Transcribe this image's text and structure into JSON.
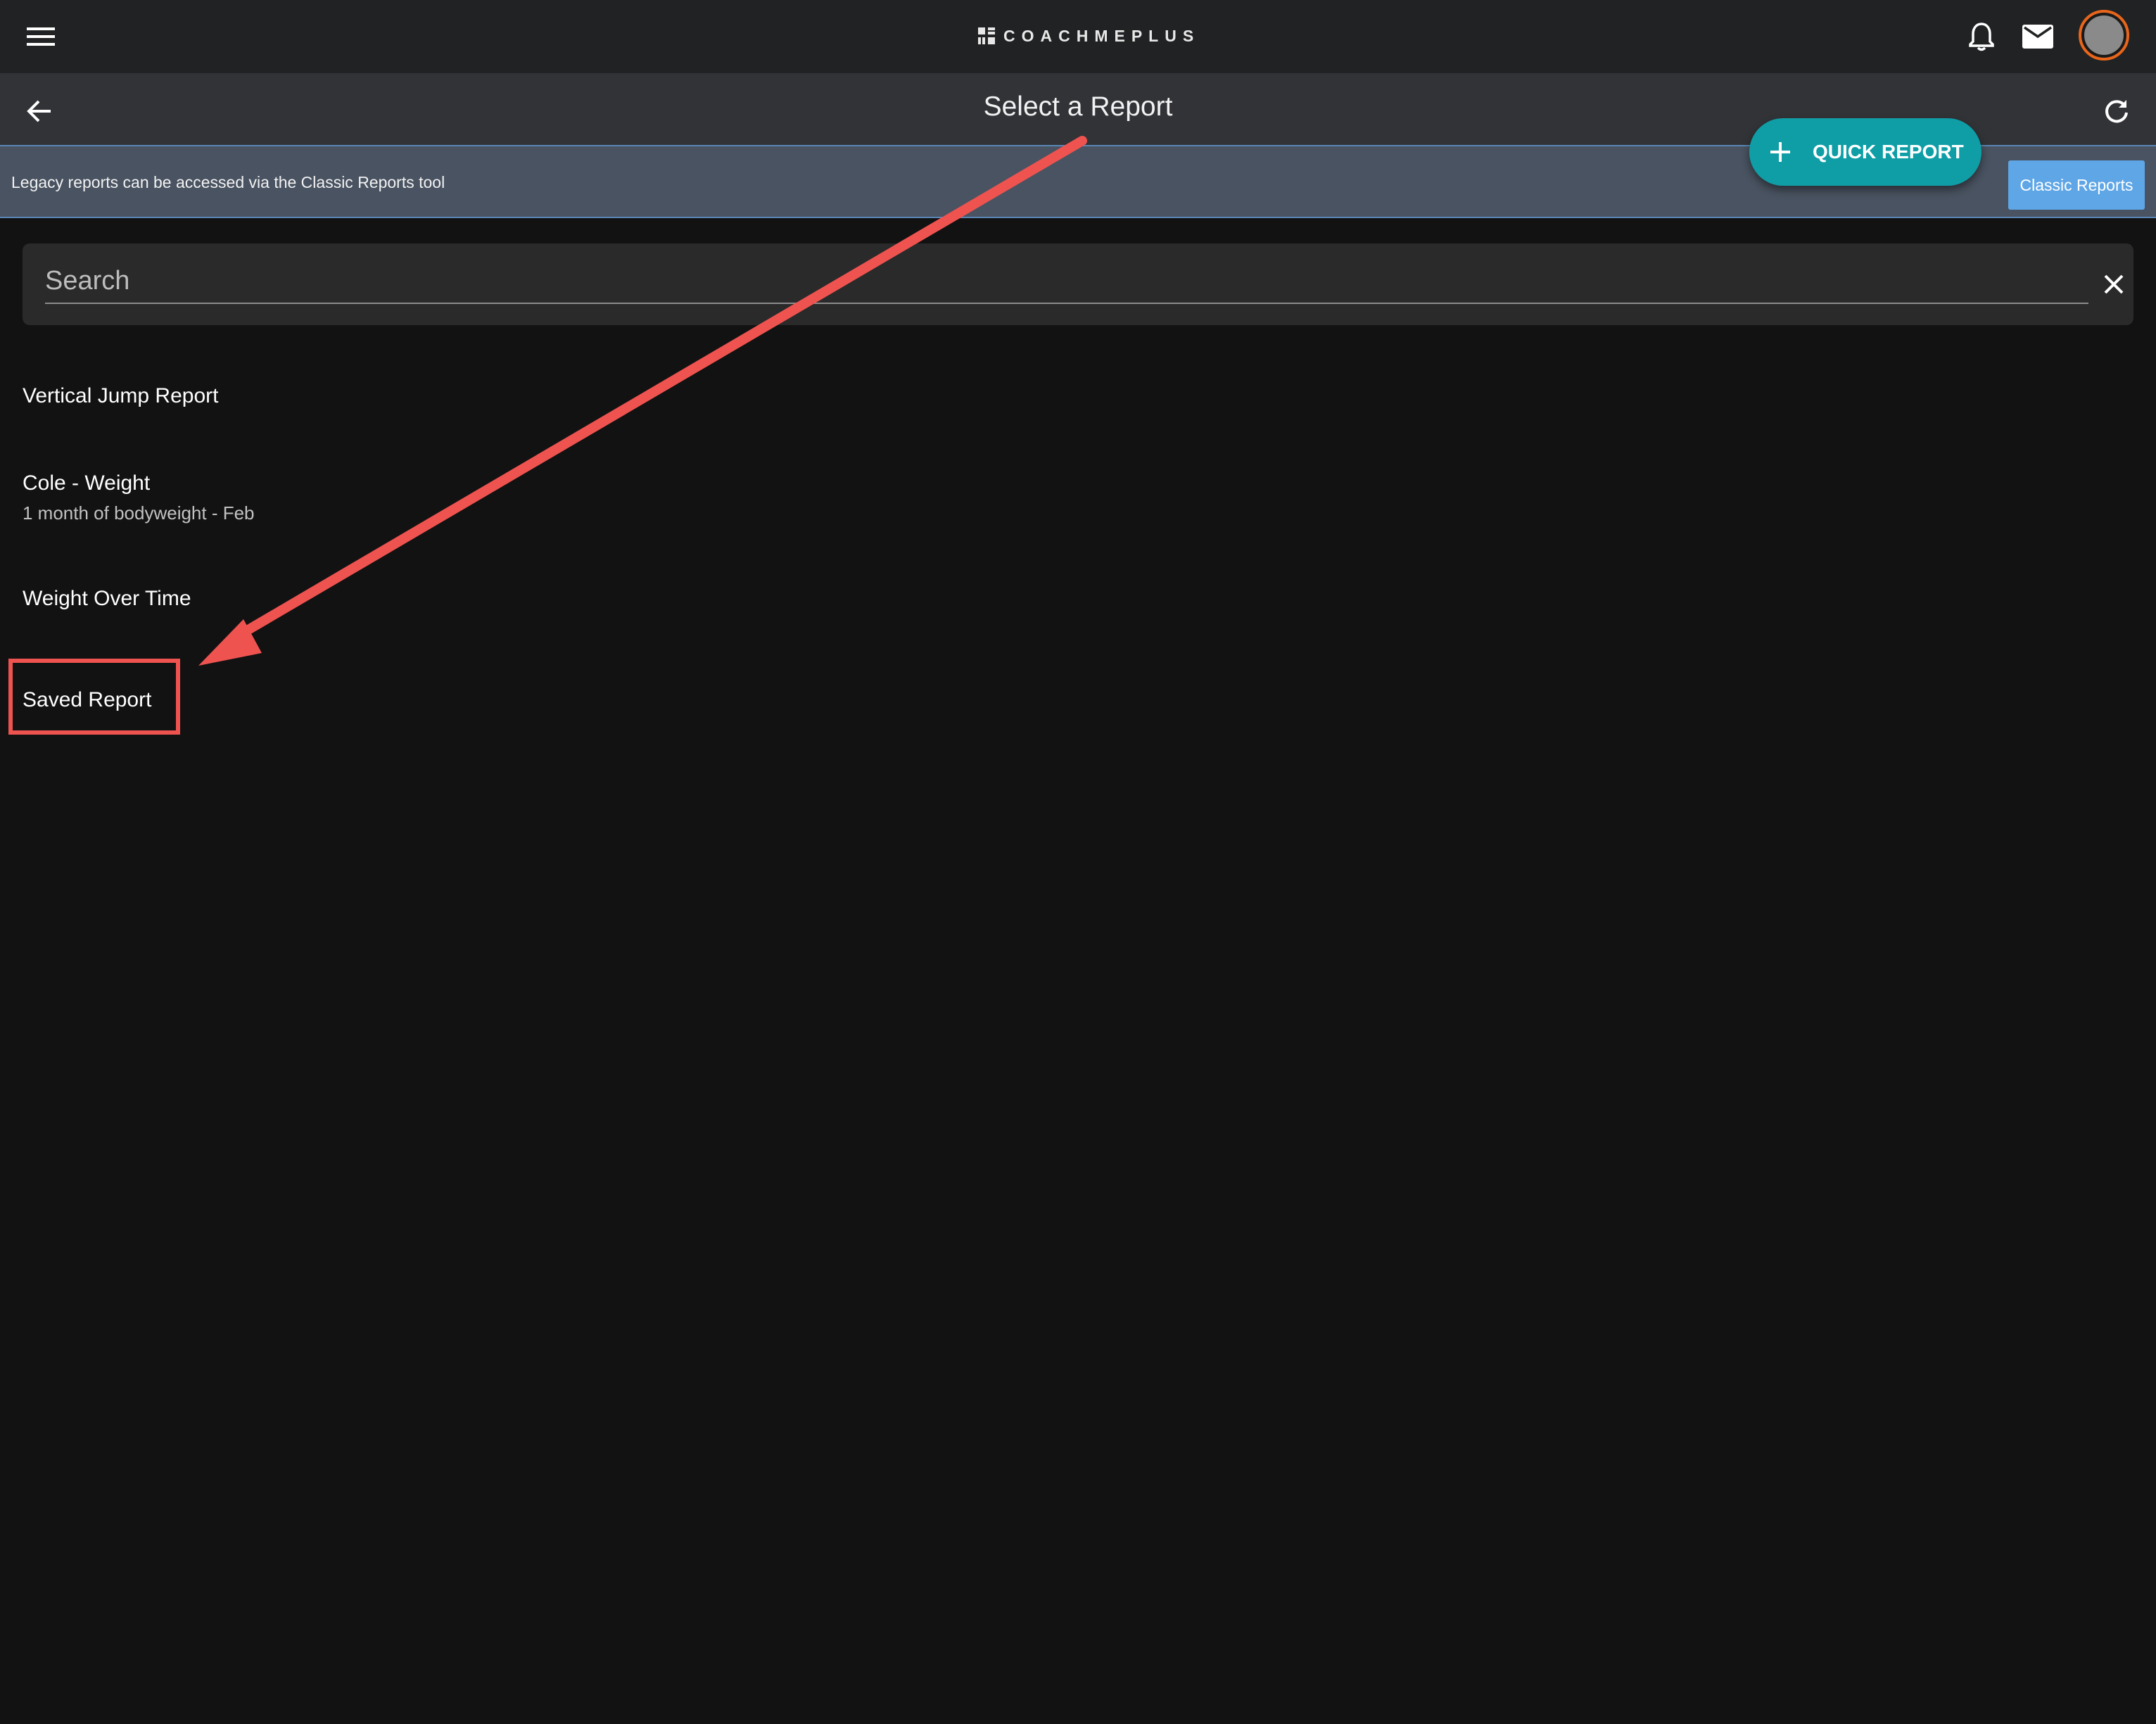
{
  "app": {
    "logo_text": "COACHMEPLUS",
    "accent_color": "#0f9ea6",
    "avatar_ring_color": "#e8661b"
  },
  "topbar": {
    "menu_icon": "hamburger-menu-icon",
    "notifications_icon": "bell-icon",
    "messages_icon": "mail-icon"
  },
  "header": {
    "title": "Select a Report",
    "back_icon": "arrow-left-icon",
    "refresh_icon": "refresh-icon"
  },
  "banner": {
    "text": "Legacy reports can be accessed via the Classic Reports tool",
    "classic_button_label": "Classic Reports",
    "classic_button_color": "#5fa6e6"
  },
  "quick_report": {
    "label": "QUICK REPORT",
    "icon": "plus-icon"
  },
  "search": {
    "placeholder": "Search",
    "value": "",
    "clear_icon": "close-icon"
  },
  "reports": [
    {
      "title": "Vertical Jump Report",
      "subtitle": ""
    },
    {
      "title": "Cole - Weight",
      "subtitle": "1 month of bodyweight - Feb"
    },
    {
      "title": "Weight Over Time",
      "subtitle": ""
    },
    {
      "title": "Saved Report",
      "subtitle": ""
    }
  ],
  "annotation": {
    "color": "#ef5350",
    "highlighted_item": "Saved Report"
  }
}
